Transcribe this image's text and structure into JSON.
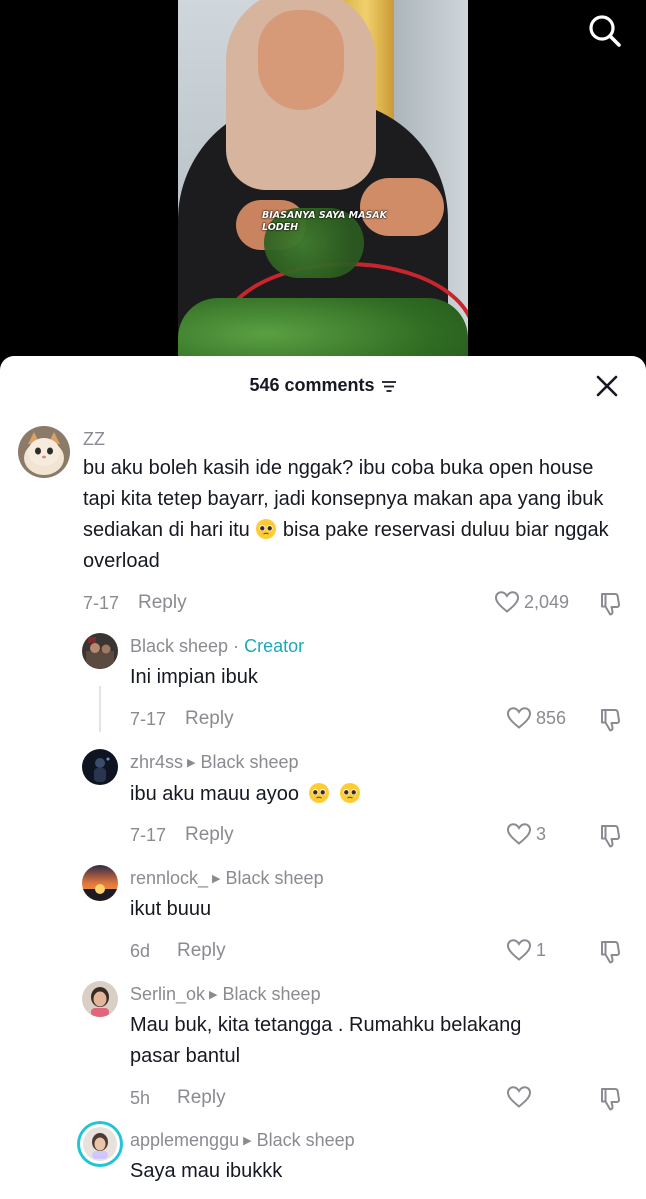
{
  "video": {
    "caption_line1": "BIASANYA SAYA MASAK",
    "caption_line2": "LODEH"
  },
  "comments_panel": {
    "count_label": "546 comments"
  },
  "comments": [
    {
      "username": "ZZ",
      "text_parts": [
        "bu aku boleh kasih ide nggak? ibu coba buka open house tapi kita tetep bayarr, jadi konsepnya makan apa yang ibuk sediakan di hari itu",
        "bisa pake reservasi duluu biar nggak overload"
      ],
      "date": "7-17",
      "reply_label": "Reply",
      "likes": "2,049"
    },
    {
      "username": "Black sheep",
      "badge": "Creator",
      "badge_sep": "·",
      "text": "Ini impian ibuk",
      "date": "7-17",
      "reply_label": "Reply",
      "likes": "856"
    },
    {
      "username": "zhr4ss",
      "reply_to": "Black sheep",
      "text": "ibu aku mauu ayoo",
      "date": "7-17",
      "reply_label": "Reply",
      "likes": "3"
    },
    {
      "username": "rennlock_",
      "reply_to": "Black sheep",
      "text": "ikut buuu",
      "date": "6d",
      "reply_label": "Reply",
      "likes": "1"
    },
    {
      "username": "Serlin_ok",
      "reply_to": "Black sheep",
      "text_lines": [
        "Mau buk, kita tetangga . Rumahku belakang",
        "pasar bantul"
      ],
      "date": "5h",
      "reply_label": "Reply",
      "likes": ""
    },
    {
      "username": "applemenggu",
      "reply_to": "Black sheep",
      "text": "Saya mau ibukkk"
    }
  ],
  "icons": {
    "search": "search-icon",
    "close": "close-icon",
    "sort": "sort-icon",
    "like": "heart-outline-icon",
    "dislike": "thumbs-down-icon",
    "emoji": "pleading-face-emoji"
  },
  "colors": {
    "creator_badge": "#1da8b9",
    "secondary_text": "#8a8b91",
    "primary_text": "#161823"
  }
}
